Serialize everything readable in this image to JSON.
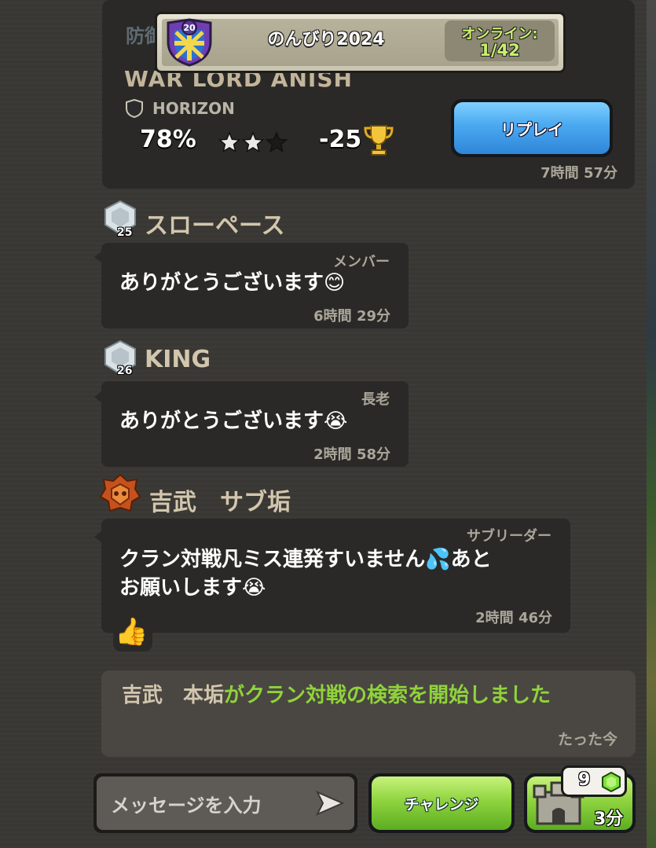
{
  "header": {
    "clan_level": "20",
    "clan_name": "のんびり2024",
    "online_label": "オンライン:",
    "online_count": "1/42"
  },
  "war_card": {
    "partial_title": "防御",
    "attacker": "WAR LORD ANISH",
    "defender": "HORIZON",
    "percent": "78%",
    "stars_earned": 2,
    "stars_total": 3,
    "trophy_change": "-25",
    "replay_label": "リプレイ",
    "time": "7時間 57分"
  },
  "messages": [
    {
      "sender": "スローペース",
      "level": "25",
      "role": "メンバー",
      "text": "ありがとうございます😊",
      "time": "6時間 29分"
    },
    {
      "sender": "KING",
      "level": "26",
      "role": "長老",
      "text": "ありがとうございます😭",
      "time": "2時間 58分"
    },
    {
      "sender": "吉武　サブ垢",
      "role": "サブリーダー",
      "text_line1": "クラン対戦凡ミス連発すいません💦あと",
      "text_line2": "お願いします😭",
      "time": "2時間 46分",
      "reaction": "👍"
    }
  ],
  "system_message": {
    "name": "吉武　本垢",
    "text": "がクラン対戦の検索を開始しました",
    "time": "たった今"
  },
  "bottom_bar": {
    "input_placeholder": "メッセージを入力",
    "challenge_label": "チャレンジ",
    "gem_count": "9",
    "castle_timer": "3分"
  },
  "colors": {
    "background": "#3a3835",
    "bubble": "#2a2927",
    "replay_blue": "#4aa8f0",
    "action_green": "#8fd43f",
    "system_green": "#8fd33a",
    "name_tan": "#d2c6ad"
  }
}
